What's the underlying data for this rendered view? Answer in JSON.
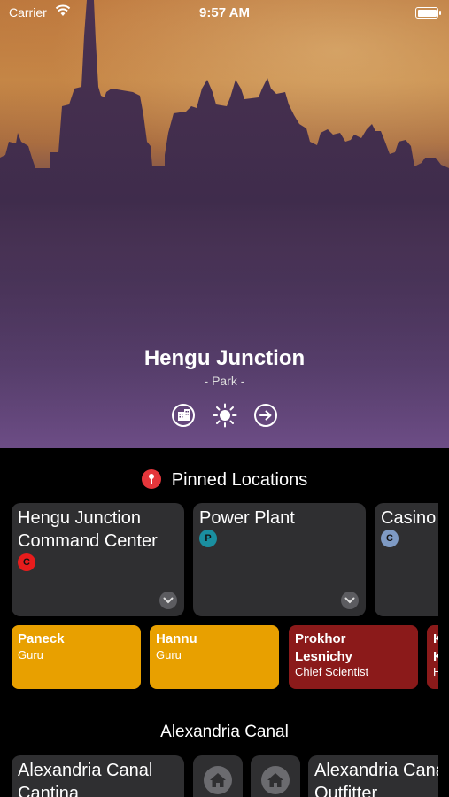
{
  "status_bar": {
    "carrier": "Carrier",
    "time": "9:57 AM"
  },
  "location": {
    "title": "Hengu Junction",
    "subtitle": "- Park -"
  },
  "pinned": {
    "title": "Pinned Locations",
    "cards": [
      {
        "name": "Hengu Junction\nCommand Center",
        "badge": "C",
        "badge_color": "#e81c1c"
      },
      {
        "name": "Power Plant",
        "badge": "P",
        "badge_color": "#1a8fa0"
      },
      {
        "name": "Casino",
        "badge": "C",
        "badge_color": "#7e9ac4"
      }
    ],
    "people": [
      {
        "name": "Paneck",
        "role": "Guru",
        "color": "#e8a000"
      },
      {
        "name": "Hannu",
        "role": "Guru",
        "color": "#e8a000"
      },
      {
        "name": "Prokhor\nLesnichy",
        "role": "Chief Scientist",
        "color": "#8b1a1a"
      },
      {
        "name": "K\nK",
        "role": "H",
        "color": "#8b1a1a"
      }
    ]
  },
  "area": {
    "title": "Alexandria Canal",
    "cards": [
      {
        "name": "Alexandria Canal\nCantina"
      },
      {
        "name": "Alexandria Canal\nOutfitter"
      }
    ]
  },
  "colors": {
    "background": "#000000",
    "card": "#2f2f31"
  }
}
